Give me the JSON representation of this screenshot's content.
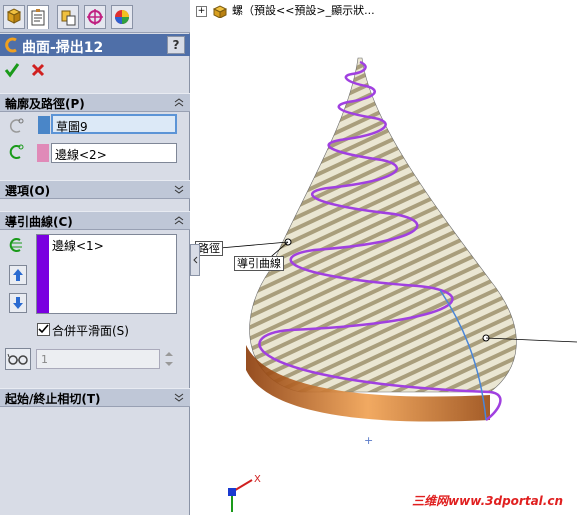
{
  "panel": {
    "title": "曲面-掃出12",
    "help": "?",
    "sections": {
      "profile_path": {
        "header": "輪廓及路徑(P)",
        "profile_value": "草圖9",
        "path_value": "邊線<2>"
      },
      "options": {
        "header": "選項(O)"
      },
      "guide_curves": {
        "header": "導引曲線(C)",
        "list_item": "邊線<1>",
        "merge_smooth_label": "合併平滑面(S)",
        "merge_smooth_checked": true,
        "section_count_value": "1"
      },
      "start_end_tangency": {
        "header": "起始/終止相切(T)"
      }
    },
    "colors": {
      "title_bg": "#4f6fa8",
      "profile_swatch": "#4a86c8",
      "path_swatch": "#e08ab8",
      "guide_swatch": "#7a00e0"
    }
  },
  "graphics": {
    "tree_text": "螺（預設<<預設>_顯示狀...",
    "callout_path": "路徑",
    "callout_guide": "導引曲線",
    "triad_x": "X",
    "watermark": "三维网www.3dportal.cn"
  }
}
